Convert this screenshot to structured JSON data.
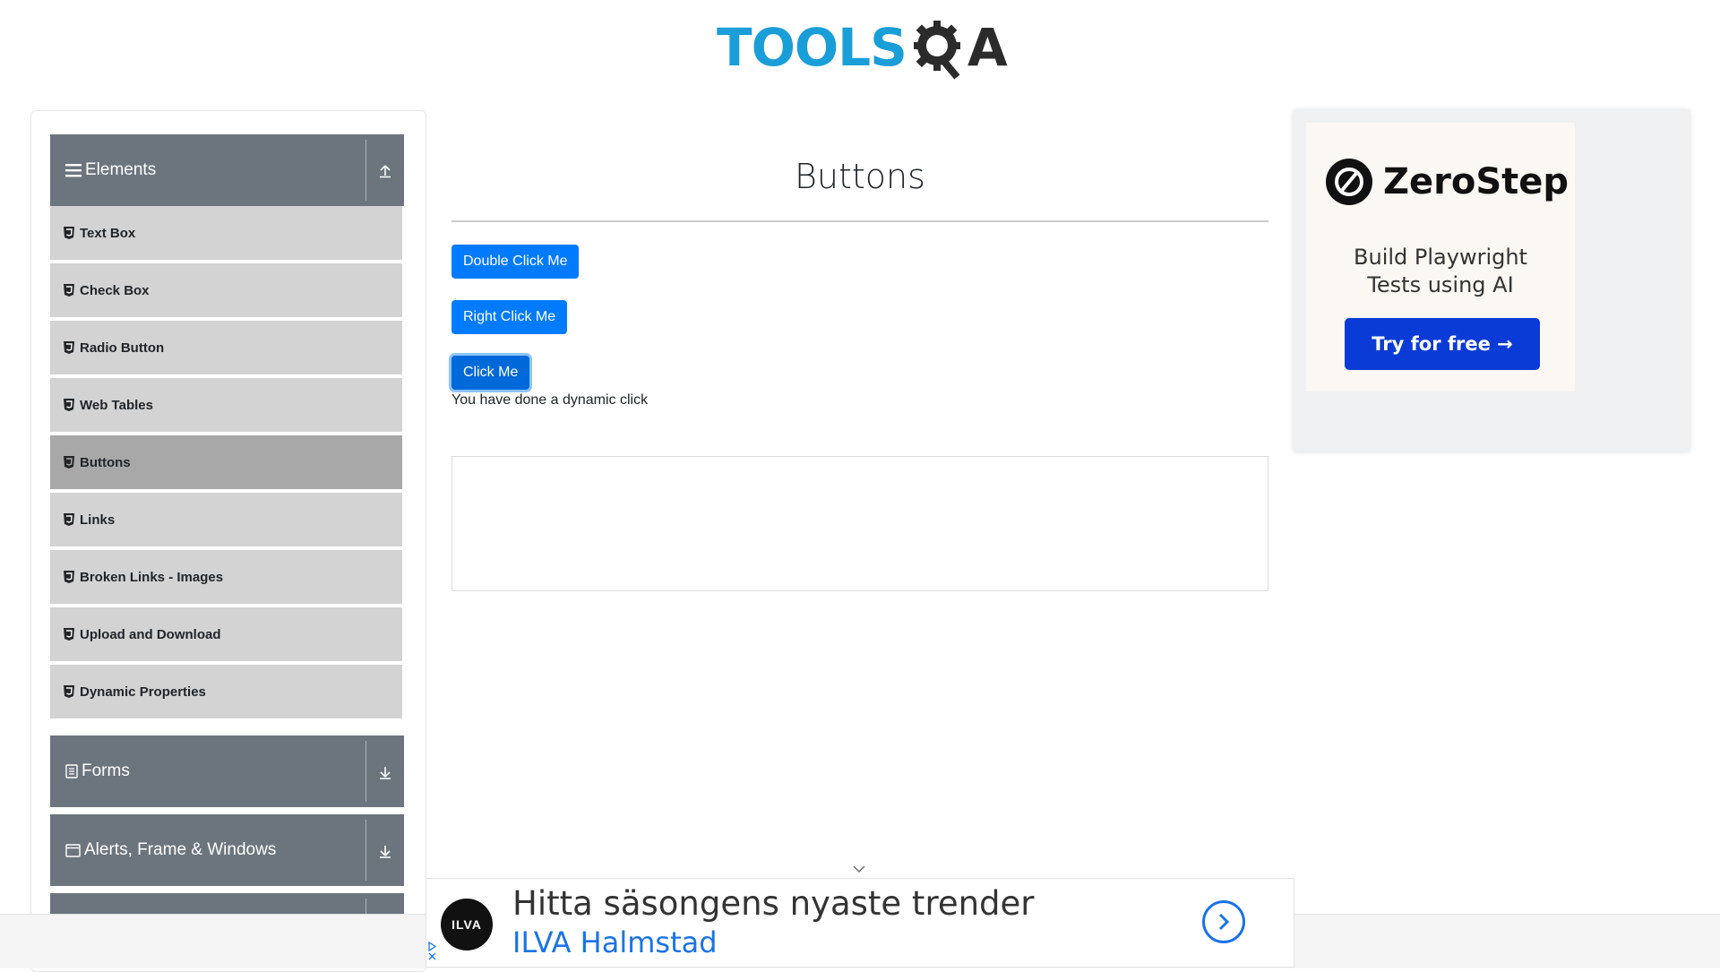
{
  "header": {
    "logo_part1": "TOOLS",
    "logo_part2": "A",
    "logo_alt": "ToolsQA"
  },
  "sidebar": {
    "groups": [
      {
        "title": "Elements",
        "expanded": true,
        "arrow": "up"
      },
      {
        "title": "Forms",
        "expanded": false,
        "arrow": "down"
      },
      {
        "title": "Alerts, Frame & Windows",
        "expanded": false,
        "arrow": "down"
      }
    ],
    "items": [
      {
        "label": "Text Box",
        "active": false
      },
      {
        "label": "Check Box",
        "active": false
      },
      {
        "label": "Radio Button",
        "active": false
      },
      {
        "label": "Web Tables",
        "active": false
      },
      {
        "label": "Buttons",
        "active": true
      },
      {
        "label": "Links",
        "active": false
      },
      {
        "label": "Broken Links - Images",
        "active": false
      },
      {
        "label": "Upload and Download",
        "active": false
      },
      {
        "label": "Dynamic Properties",
        "active": false
      }
    ]
  },
  "main": {
    "title": "Buttons",
    "buttons": {
      "double_click": "Double Click Me",
      "right_click": "Right Click Me",
      "click": "Click Me"
    },
    "dynamic_click_message": "You have done a dynamic click"
  },
  "ad_right": {
    "brand": "ZeroStep",
    "tagline_line1": "Build Playwright",
    "tagline_line2": "Tests using AI",
    "cta": "Try for free →"
  },
  "ad_bottom": {
    "logo": "ILVA",
    "headline": "Hitta säsongens nyaste trender",
    "advertiser": "ILVA Halmstad"
  },
  "colors": {
    "primary": "#007bff",
    "sidebar_header": "#6c757d",
    "sidebar_item": "#d3d3d3",
    "sidebar_item_active": "#a8a8a8",
    "logo_blue": "#1a9ed8",
    "zerostep_cta": "#0b3bd6",
    "ad_link": "#1a73e8"
  }
}
